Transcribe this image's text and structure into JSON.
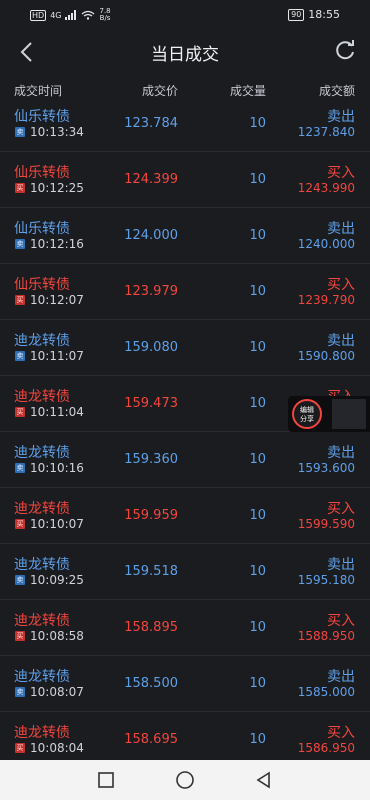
{
  "status_bar": {
    "network": "HD",
    "signal": "4G",
    "speed_value": "7.8",
    "speed_unit": "B/s",
    "battery": "90",
    "time": "18:55"
  },
  "header": {
    "title": "当日成交"
  },
  "columns": [
    "成交时间",
    "成交价",
    "成交量",
    "成交额"
  ],
  "trades": [
    {
      "name": "仙乐转债",
      "time": "10:13:34",
      "price": "123.784",
      "qty": "10",
      "side": "卖出",
      "amount": "1237.840",
      "type": "sell",
      "tag": "卖"
    },
    {
      "name": "仙乐转债",
      "time": "10:12:25",
      "price": "124.399",
      "qty": "10",
      "side": "买入",
      "amount": "1243.990",
      "type": "buy",
      "tag": "买"
    },
    {
      "name": "仙乐转债",
      "time": "10:12:16",
      "price": "124.000",
      "qty": "10",
      "side": "卖出",
      "amount": "1240.000",
      "type": "sell",
      "tag": "卖"
    },
    {
      "name": "仙乐转债",
      "time": "10:12:07",
      "price": "123.979",
      "qty": "10",
      "side": "买入",
      "amount": "1239.790",
      "type": "buy",
      "tag": "买"
    },
    {
      "name": "迪龙转债",
      "time": "10:11:07",
      "price": "159.080",
      "qty": "10",
      "side": "卖出",
      "amount": "1590.800",
      "type": "sell",
      "tag": "卖"
    },
    {
      "name": "迪龙转债",
      "time": "10:11:04",
      "price": "159.473",
      "qty": "10",
      "side": "买入",
      "amount": "",
      "type": "buy",
      "tag": "买"
    },
    {
      "name": "迪龙转债",
      "time": "10:10:16",
      "price": "159.360",
      "qty": "10",
      "side": "卖出",
      "amount": "1593.600",
      "type": "sell",
      "tag": "卖"
    },
    {
      "name": "迪龙转债",
      "time": "10:10:07",
      "price": "159.959",
      "qty": "10",
      "side": "买入",
      "amount": "1599.590",
      "type": "buy",
      "tag": "买"
    },
    {
      "name": "迪龙转债",
      "time": "10:09:25",
      "price": "159.518",
      "qty": "10",
      "side": "卖出",
      "amount": "1595.180",
      "type": "sell",
      "tag": "卖"
    },
    {
      "name": "迪龙转债",
      "time": "10:08:58",
      "price": "158.895",
      "qty": "10",
      "side": "买入",
      "amount": "1588.950",
      "type": "buy",
      "tag": "买"
    },
    {
      "name": "迪龙转债",
      "time": "10:08:07",
      "price": "158.500",
      "qty": "10",
      "side": "卖出",
      "amount": "1585.000",
      "type": "sell",
      "tag": "卖"
    },
    {
      "name": "迪龙转债",
      "time": "10:08:04",
      "price": "158.695",
      "qty": "10",
      "side": "买入",
      "amount": "1586.950",
      "type": "buy",
      "tag": "买"
    }
  ],
  "floating_button": {
    "label_line1": "编辑",
    "label_line2": "分享"
  },
  "colors": {
    "buy": "#f2463e",
    "sell": "#5ea0e8",
    "background": "#1b1c20"
  }
}
